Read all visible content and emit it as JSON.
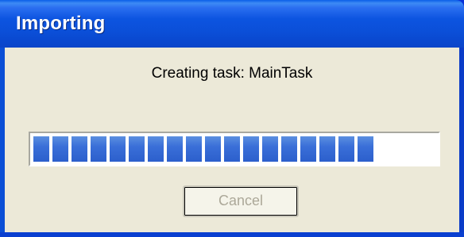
{
  "window": {
    "title": "Importing"
  },
  "dialog": {
    "status_text": "Creating task: MainTask",
    "progress": {
      "filled_blocks": 18,
      "total_blocks": 21,
      "fraction": 0.86,
      "block_color": "#3a6fd8"
    },
    "cancel_label": "Cancel",
    "cancel_enabled": false
  },
  "colors": {
    "title_bar": "#0a4fd8",
    "client_background": "#ece9d8",
    "disabled_text": "#aca899"
  }
}
